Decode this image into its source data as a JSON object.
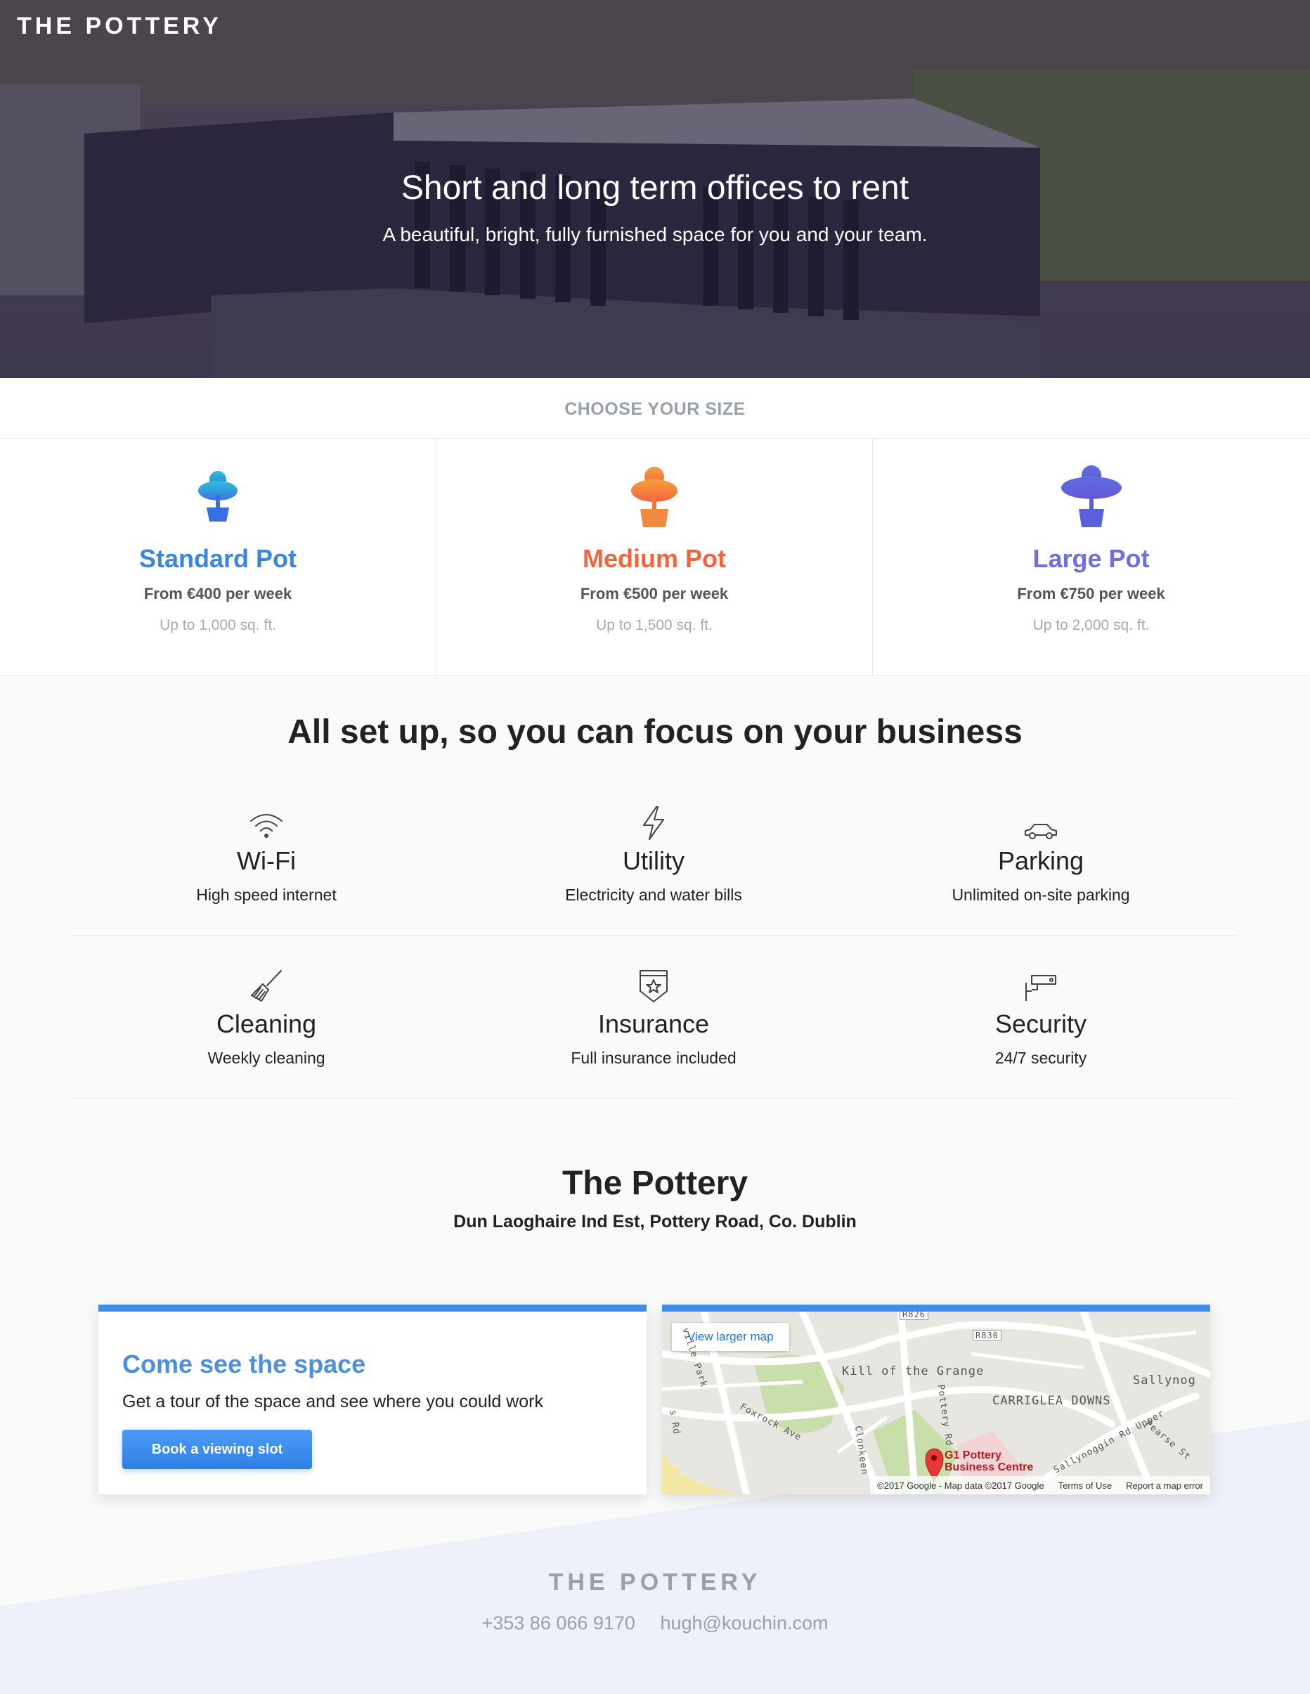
{
  "header": {
    "brand": "THE POTTERY"
  },
  "hero": {
    "title": "Short and long term offices to rent",
    "subtitle": "A beautiful, bright, fully furnished space for you and your team."
  },
  "sizes": {
    "heading": "CHOOSE YOUR SIZE",
    "items": [
      {
        "name": "Standard Pot",
        "price": "From €400 per week",
        "area": "Up to 1,000 sq. ft.",
        "color": "#3a86e0",
        "icon": "small-pot-tree-icon"
      },
      {
        "name": "Medium Pot",
        "price": "From €500 per week",
        "area": "Up to 1,500 sq. ft.",
        "color": "#f0653e",
        "icon": "medium-pot-tree-icon"
      },
      {
        "name": "Large Pot",
        "price": "From €750 per week",
        "area": "Up to 2,000 sq. ft.",
        "color": "#6f6fe0",
        "icon": "large-pot-tree-icon"
      }
    ]
  },
  "features": {
    "title": "All set up, so you can focus on your business",
    "items": [
      {
        "name": "Wi-Fi",
        "desc": "High speed internet",
        "icon": "wifi-icon"
      },
      {
        "name": "Utility",
        "desc": "Electricity and water bills",
        "icon": "lightning-icon"
      },
      {
        "name": "Parking",
        "desc": "Unlimited on-site parking",
        "icon": "car-icon"
      },
      {
        "name": "Cleaning",
        "desc": "Weekly cleaning",
        "icon": "broom-icon"
      },
      {
        "name": "Insurance",
        "desc": "Full insurance included",
        "icon": "shield-star-icon"
      },
      {
        "name": "Security",
        "desc": "24/7 security",
        "icon": "security-camera-icon"
      }
    ]
  },
  "location": {
    "name": "The Pottery",
    "address": "Dun Laoghaire Ind Est, Pottery Road, Co. Dublin"
  },
  "cta": {
    "title": "Come see the space",
    "text": "Get a tour of the space and see where you could work",
    "button": "Book a viewing slot"
  },
  "map": {
    "link": "View larger map",
    "labels": [
      "Kill of the Grange",
      "CARRIGLEA DOWNS",
      "Sallynog",
      "R830",
      "R826",
      "Foxrock Ave",
      "Clonkeen",
      "Pottery Rd",
      "Sallynoggin Rd Upper",
      "Pearse St",
      "ville Park",
      "s Rd"
    ],
    "marker": "G1 Pottery Business Centre",
    "footer": [
      "©2017 Google - Map data ©2017 Google",
      "Terms of Use",
      "Report a map error"
    ]
  },
  "footer": {
    "brand": "THE POTTERY",
    "phone": "+353 86 066 9170",
    "email": "hugh@kouchin.com"
  }
}
